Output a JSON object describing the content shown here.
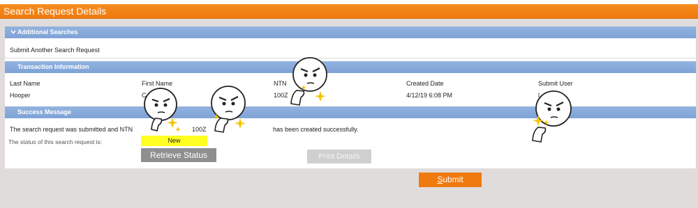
{
  "title": "Search Request Details",
  "sections": {
    "additional": {
      "header": "Additional Searches",
      "link": "Submit Another Search Request"
    },
    "transaction": {
      "header": "Transaction Information",
      "columns": [
        "Last Name",
        "First Name",
        "NTN",
        "Created Date",
        "Submit User"
      ],
      "values": [
        "Hooper",
        "C",
        "100Z",
        "4/12/19 6:08 PM",
        "l"
      ]
    },
    "success": {
      "header": "Success Message",
      "message_prefix": "The search request was submitted and NTN",
      "ntn_value": "100Z",
      "message_suffix": "has been created successfully.",
      "status_label": "The status of this search request is:",
      "status_value": "New"
    }
  },
  "buttons": {
    "retrieve": "Retrieve Status",
    "print": "Print Details",
    "submit_first": "S",
    "submit_rest": "ubmit"
  },
  "colors": {
    "title_bar": "#f68d1e",
    "section_header": "#7ea3d7",
    "status_highlight": "#ffff22",
    "submit": "#ef7a10"
  },
  "icons": [
    "chevron-down-icon",
    "thinking-face-sticker"
  ]
}
